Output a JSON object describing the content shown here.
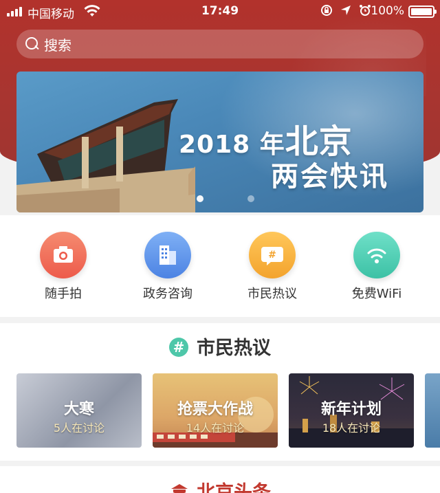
{
  "status_bar": {
    "carrier": "中国移动",
    "time": "17:49",
    "battery_text": "100%",
    "battery_level": 1.0
  },
  "search": {
    "placeholder": "搜索"
  },
  "banner": {
    "year_text": "2018 年",
    "city_text": "北京",
    "subtitle": "两会快讯",
    "page_count": 2,
    "active_page": 0
  },
  "quick_nav": [
    {
      "label": "随手拍",
      "icon": "camera-icon",
      "color": "#ed5b4b"
    },
    {
      "label": "政务咨询",
      "icon": "building-icon",
      "color": "#4c83e3"
    },
    {
      "label": "市民热议",
      "icon": "chat-hash-icon",
      "color": "#f3a32d"
    },
    {
      "label": "免费WiFi",
      "icon": "wifi-icon",
      "color": "#3cc1a5"
    }
  ],
  "hot_section": {
    "title": "市民热议",
    "icon": "hash-icon",
    "cards": [
      {
        "title": "大寒",
        "subtitle": "5人在讨论"
      },
      {
        "title": "抢票大作战",
        "subtitle": "14人在讨论"
      },
      {
        "title": "新年计划",
        "subtitle": "18人在讨论"
      },
      {
        "title": "",
        "subtitle": ""
      }
    ]
  },
  "news_section": {
    "title": "北京头条"
  },
  "colors": {
    "header_red": "#b2322c",
    "news_red": "#c2392f",
    "hash_green": "#4ec7a9"
  }
}
